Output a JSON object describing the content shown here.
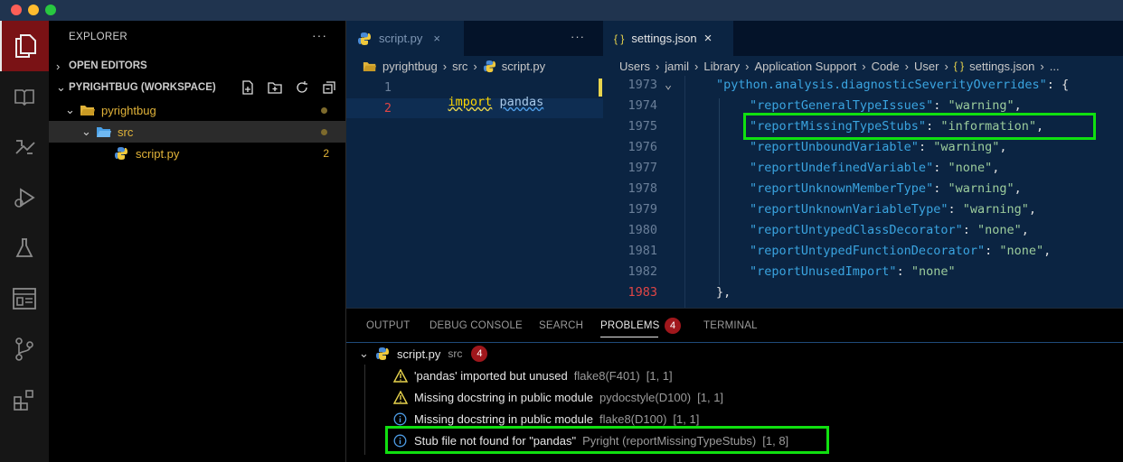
{
  "colors": {
    "accent_green": "#10e010",
    "badge_red": "#a0171c",
    "folder_yellow": "#e1b339",
    "warning_yellow": "#e8d44d",
    "info_blue": "#4e9de6"
  },
  "activity_bar": {
    "icons": [
      "files-icon",
      "book-icon",
      "git-graph-icon",
      "debug-icon",
      "flask-icon",
      "browser-icon",
      "source-control-icon",
      "extensions-icon"
    ]
  },
  "sidebar": {
    "title": "EXPLORER",
    "more_actions": "···",
    "open_editors": "OPEN EDITORS",
    "workspace": "PYRIGHTBUG (WORKSPACE)",
    "tree": {
      "root": "pyrightbug",
      "folder": "src",
      "file": "script.py",
      "file_badge": "2"
    }
  },
  "editor_left": {
    "tab": "script.py",
    "more": "···",
    "breadcrumbs": [
      "pyrightbug",
      "src",
      "script.py"
    ],
    "line_numbers": [
      "1",
      "2"
    ],
    "code": {
      "keyword": "import",
      "module": "pandas"
    }
  },
  "editor_right": {
    "tab": "settings.json",
    "tab_icon": "{ }",
    "close": "×",
    "breadcrumbs": [
      "Users",
      "jamil",
      "Library",
      "Application Support",
      "Code",
      "User",
      "settings.json",
      "..."
    ],
    "breadcrumb_json_icon": "{ }",
    "line_numbers": [
      "1973",
      "1974",
      "1975",
      "1976",
      "1977",
      "1978",
      "1979",
      "1980",
      "1981",
      "1982",
      "1983"
    ],
    "header_key": "\"python.analysis.diagnosticSeverityOverrides\"",
    "header_tail": ": {",
    "entries": [
      {
        "key": "\"reportGeneralTypeIssues\"",
        "value": "\"warning\""
      },
      {
        "key": "\"reportMissingTypeStubs\"",
        "value": "\"information\""
      },
      {
        "key": "\"reportUnboundVariable\"",
        "value": "\"warning\""
      },
      {
        "key": "\"reportUndefinedVariable\"",
        "value": "\"none\""
      },
      {
        "key": "\"reportUnknownMemberType\"",
        "value": "\"warning\""
      },
      {
        "key": "\"reportUnknownVariableType\"",
        "value": "\"warning\""
      },
      {
        "key": "\"reportUntypedClassDecorator\"",
        "value": "\"none\""
      },
      {
        "key": "\"reportUntypedFunctionDecorator\"",
        "value": "\"none\""
      },
      {
        "key": "\"reportUnusedImport\"",
        "value": "\"none\""
      }
    ],
    "closing": "},"
  },
  "panel": {
    "tabs": [
      "OUTPUT",
      "DEBUG CONSOLE",
      "SEARCH",
      "PROBLEMS",
      "TERMINAL"
    ],
    "problems_count": "4",
    "group": {
      "file": "script.py",
      "folder": "src",
      "count": "4"
    },
    "problems": [
      {
        "severity": "warning",
        "message": "'pandas' imported but unused",
        "source": "flake8(F401)",
        "pos": "[1, 1]"
      },
      {
        "severity": "warning",
        "message": "Missing docstring in public module",
        "source": "pydocstyle(D100)",
        "pos": "[1, 1]"
      },
      {
        "severity": "info",
        "message": "Missing docstring in public module",
        "source": "flake8(D100)",
        "pos": "[1, 1]"
      },
      {
        "severity": "info",
        "message": "Stub file not found for \"pandas\"",
        "source": "Pyright (reportMissingTypeStubs)",
        "pos": "[1, 8]"
      }
    ]
  }
}
